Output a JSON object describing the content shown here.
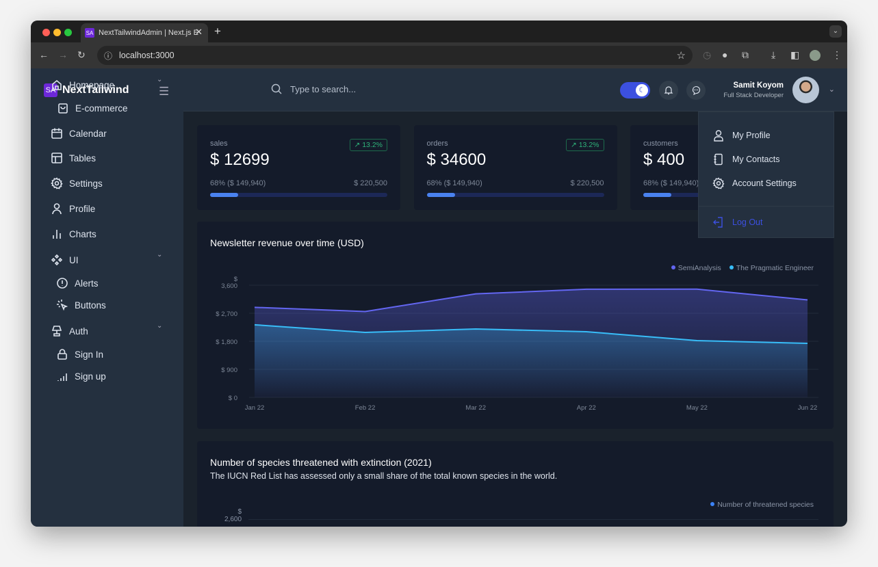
{
  "browser": {
    "tab_title": "NextTailwindAdmin | Next.js E",
    "favicon": "SA",
    "url": "localhost:3000"
  },
  "app": {
    "logo_badge": "SA",
    "logo_text": "NextTailwind",
    "search_placeholder": "Type to search...",
    "dark_mode": true,
    "user": {
      "name": "Samit Koyom",
      "role": "Full Stack Developer"
    }
  },
  "sidebar": {
    "items": [
      {
        "label": "Homepage",
        "icon": "home-icon",
        "expandable": true
      },
      {
        "label": "E-commerce",
        "icon": "bag-icon",
        "sub": true
      },
      {
        "label": "Calendar",
        "icon": "calendar-icon"
      },
      {
        "label": "Tables",
        "icon": "table-icon"
      },
      {
        "label": "Settings",
        "icon": "gear-icon"
      },
      {
        "label": "Profile",
        "icon": "user-icon"
      },
      {
        "label": "Charts",
        "icon": "bar-chart-icon"
      },
      {
        "label": "UI",
        "icon": "components-icon",
        "expandable": true
      },
      {
        "label": "Alerts",
        "icon": "alert-circle-icon",
        "sub": true
      },
      {
        "label": "Buttons",
        "icon": "pointer-click-icon",
        "sub": true
      },
      {
        "label": "Auth",
        "icon": "lamp-icon",
        "expandable": true
      },
      {
        "label": "Sign In",
        "icon": "lock-icon",
        "sub": true
      },
      {
        "label": "Sign up",
        "icon": "signal-icon",
        "sub": true
      }
    ]
  },
  "dropdown": {
    "items": [
      {
        "label": "My Profile",
        "icon": "user-icon"
      },
      {
        "label": "My Contacts",
        "icon": "contacts-icon"
      },
      {
        "label": "Account Settings",
        "icon": "gear-icon"
      }
    ],
    "logout": "Log Out",
    "logout_color": "#3c50e0"
  },
  "stats": [
    {
      "label": "sales",
      "value": "$ 12699",
      "badge": "13.2%",
      "progress_text": "68% ($ 149,940)",
      "total": "$ 220,500",
      "progress": 16
    },
    {
      "label": "orders",
      "value": "$ 34600",
      "badge": "13.2%",
      "progress_text": "68% ($ 149,940)",
      "total": "$ 220,500",
      "progress": 16
    },
    {
      "label": "customers",
      "value": "$ 400",
      "badge": "13.2%",
      "progress_text": "68% ($ 149,940)",
      "total": "$ 220,500",
      "progress": 16
    }
  ],
  "chart_data": [
    {
      "type": "area",
      "title": "Newsletter revenue over time (USD)",
      "categories": [
        "Jan 22",
        "Feb 22",
        "Mar 22",
        "Apr 22",
        "May 22",
        "Jun 22"
      ],
      "yticks": [
        "$ 0",
        "$ 900",
        "$ 1,800",
        "$ 2,700",
        "3,600"
      ],
      "yunit": "$",
      "ylim": [
        0,
        3600
      ],
      "grid": true,
      "legend": "top-right",
      "series": [
        {
          "name": "SemiAnalysis",
          "color": "#6366f1",
          "values": [
            2890,
            2756,
            3322,
            3470,
            3475,
            3129
          ]
        },
        {
          "name": "The Pragmatic Engineer",
          "color": "#38bdf8",
          "values": [
            2330,
            2085,
            2195,
            2107,
            1822,
            1734
          ]
        }
      ]
    },
    {
      "type": "bar",
      "title": "Number of species threatened with extinction (2021)",
      "subtitle": "The IUCN Red List has assessed only a small share of the total known species in the world.",
      "yunit": "$",
      "yticks": [
        "2,600"
      ],
      "legend": "top-right",
      "series": [
        {
          "name": "Number of threatened species",
          "color": "#3b82f6"
        }
      ]
    }
  ]
}
